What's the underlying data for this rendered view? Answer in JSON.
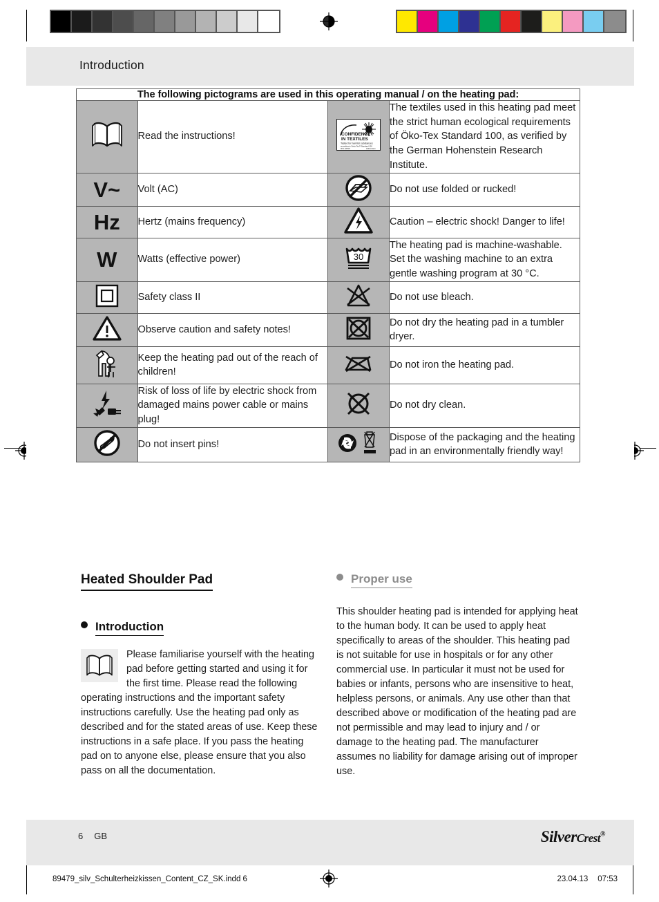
{
  "page": {
    "running_header": "Introduction",
    "page_number": "6",
    "locale_code": "GB",
    "brand": "SilverCrest",
    "brand_part1": "Silver",
    "brand_part2": "Crest",
    "brand_registered": "®",
    "print_file": "89479_silv_Schulterheizkissen_Content_CZ_SK.indd   6",
    "print_date": "23.04.13",
    "print_time": "07:53"
  },
  "calibration": {
    "gray_swatches": [
      "#000000",
      "#1b1b1b",
      "#333333",
      "#4d4d4d",
      "#666666",
      "#808080",
      "#999999",
      "#b3b3b3",
      "#cccccc",
      "#e8e8e8",
      "#ffffff"
    ],
    "color_swatches": [
      "#ffe800",
      "#e6007e",
      "#00a0e3",
      "#2e3192",
      "#00a053",
      "#e52421",
      "#1d1d1b",
      "#fbf07e",
      "#f49ac1",
      "#79cdf0",
      "#8c8c8c"
    ]
  },
  "picto_table": {
    "caption": "The following pictograms are used in this operating manual / on the heating pad:",
    "rows": [
      {
        "left_icon": "open-book-icon",
        "left_text": "Read the instructions!",
        "right_icon": "oeko-tex-confidence-in-textiles-label",
        "right_text": "The textiles used in this heating pad meet the strict human ecological requirements of Öko-Tex Standard 100, as verified by the German Hohenstein Research Institute."
      },
      {
        "left_icon": "volt-ac-symbol",
        "left_icon_text": "V~",
        "left_text": "Volt (AC)",
        "right_icon": "do-not-use-folded-icon",
        "right_text": "Do not use folded or rucked!"
      },
      {
        "left_icon": "hertz-symbol",
        "left_icon_text": "Hz",
        "left_text": "Hertz (mains frequency)",
        "right_icon": "electric-shock-warning-icon",
        "right_text": "Caution – electric shock! Danger to life!"
      },
      {
        "left_icon": "watts-symbol",
        "left_icon_text": "W",
        "left_text": "Watts (effective power)",
        "right_icon": "machine-wash-30-gentle-icon",
        "right_icon_text": "30",
        "right_text": "The heating pad is machine-washable. Set the washing machine to an extra gentle washing program at 30 °C."
      },
      {
        "left_icon": "safety-class-2-icon",
        "left_text": "Safety class II",
        "right_icon": "do-not-bleach-icon",
        "right_text": "Do not use bleach."
      },
      {
        "left_icon": "warning-triangle-icon",
        "left_text": "Observe caution and safety notes!",
        "right_icon": "do-not-tumble-dry-icon",
        "right_text": "Do not dry the heating pad in a tumbler dryer."
      },
      {
        "left_icon": "keep-away-from-children-icon",
        "left_text": "Keep the heating pad out of the reach of children!",
        "right_icon": "do-not-iron-icon",
        "right_text": "Do not iron the heating pad."
      },
      {
        "left_icon": "damaged-cable-shock-hazard-icon",
        "left_text": "Risk of loss of life by electric shock from damaged mains power cable or mains plug!",
        "right_icon": "do-not-dry-clean-icon",
        "right_text": "Do not dry clean."
      },
      {
        "left_icon": "do-not-insert-pins-icon",
        "left_text": "Do not insert pins!",
        "right_icon": "green-dot-and-weee-bin-icon",
        "right_text": "Dispose of the packaging and the heating pad in an environmentally friendly way!"
      }
    ],
    "oeko_tex": {
      "line1": "CONFIDENCE",
      "line2": "IN TEXTILES",
      "line3": "Tested for harmful substances",
      "line4": "according to Oeko-Tex® Standard 100",
      "line5": "06.1.42519",
      "line6": "Hohenstein"
    }
  },
  "article": {
    "product_title": "Heated Shoulder Pad",
    "left_section": {
      "heading": "Introduction",
      "body": "Please familiarise yourself with the heating pad before getting started and using it for the first time. Please read the following operating instructions and the important safety instructions carefully. Use the heating pad only as described and for the stated areas of use. Keep these instructions in a safe place. If you pass the heating pad on to anyone else, please ensure that you also pass on all the documentation."
    },
    "right_section": {
      "heading": "Proper use",
      "body": "This shoulder heating pad is intended for applying heat to the human body. It can be used to apply heat specifically to areas of the shoulder. This heating pad is not suitable for use in hospitals or for any other commercial use. In particular it must not be used for babies or infants, persons who are insensitive to heat, helpless persons, or animals. Any use other than that described above or modification of the heating pad are not permissible and may lead to injury and / or damage to the heating pad. The manufacturer assumes no liability for damage arising out of improper use."
    }
  }
}
